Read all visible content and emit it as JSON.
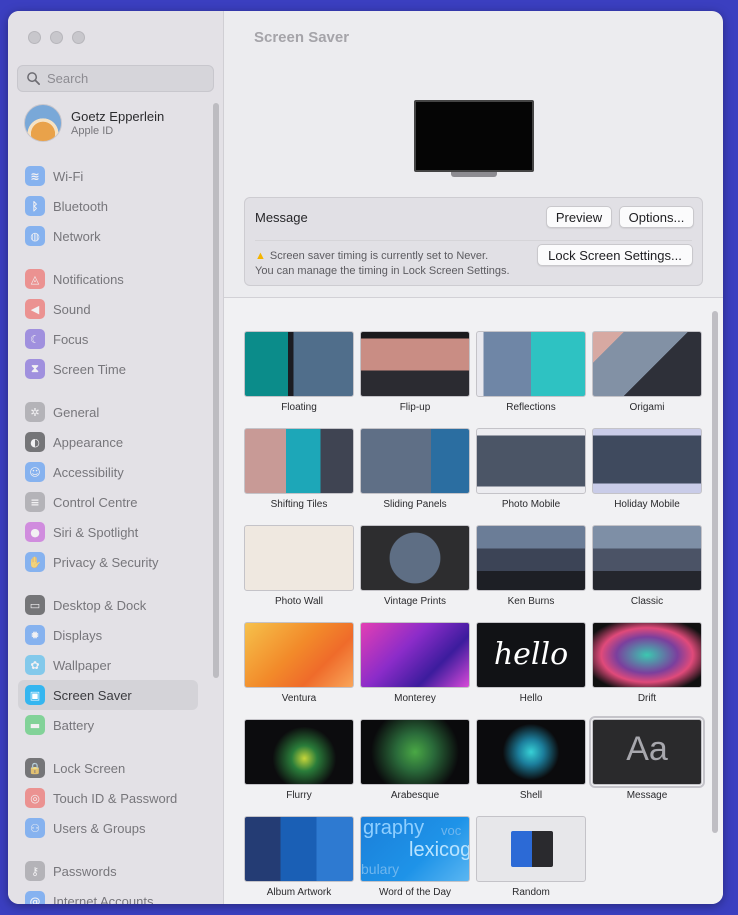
{
  "sidebar": {
    "search_placeholder": "Search",
    "profile": {
      "name": "Goetz Epperlein",
      "subtitle": "Apple ID"
    },
    "items": [
      {
        "label": "Wi-Fi",
        "icon": "wifi-icon",
        "color": "#3b8cf7"
      },
      {
        "label": "Bluetooth",
        "icon": "bluetooth-icon",
        "color": "#3b8cf7"
      },
      {
        "label": "Network",
        "icon": "globe-icon",
        "color": "#3b8cf7"
      },
      {
        "label": "Notifications",
        "icon": "bell-icon",
        "color": "#f2534c"
      },
      {
        "label": "Sound",
        "icon": "speaker-icon",
        "color": "#f2534c"
      },
      {
        "label": "Focus",
        "icon": "moon-icon",
        "color": "#6b4fd8"
      },
      {
        "label": "Screen Time",
        "icon": "hourglass-icon",
        "color": "#6b4fd8"
      },
      {
        "label": "General",
        "icon": "gear-icon",
        "color": "#8e8e93"
      },
      {
        "label": "Appearance",
        "icon": "appearance-icon",
        "color": "#1d1d1f"
      },
      {
        "label": "Accessibility",
        "icon": "accessibility-icon",
        "color": "#3b8cf7"
      },
      {
        "label": "Control Centre",
        "icon": "toggles-icon",
        "color": "#8e8e93"
      },
      {
        "label": "Siri & Spotlight",
        "icon": "siri-icon",
        "color": "#c148d8"
      },
      {
        "label": "Privacy & Security",
        "icon": "hand-icon",
        "color": "#3b8cf7"
      },
      {
        "label": "Desktop & Dock",
        "icon": "dock-icon",
        "color": "#1d1d1f"
      },
      {
        "label": "Displays",
        "icon": "sun-icon",
        "color": "#3b8cf7"
      },
      {
        "label": "Wallpaper",
        "icon": "flower-icon",
        "color": "#35b6f0"
      },
      {
        "label": "Screen Saver",
        "icon": "screensaver-icon",
        "color": "#35b6f0",
        "active": true
      },
      {
        "label": "Battery",
        "icon": "battery-icon",
        "color": "#34c759"
      },
      {
        "label": "Lock Screen",
        "icon": "lock-icon",
        "color": "#1d1d1f"
      },
      {
        "label": "Touch ID & Password",
        "icon": "fingerprint-icon",
        "color": "#f2534c"
      },
      {
        "label": "Users & Groups",
        "icon": "users-icon",
        "color": "#3b8cf7"
      },
      {
        "label": "Passwords",
        "icon": "key-icon",
        "color": "#8e8e93"
      },
      {
        "label": "Internet Accounts",
        "icon": "at-icon",
        "color": "#3b8cf7"
      }
    ]
  },
  "main": {
    "title": "Screen Saver",
    "panel": {
      "title": "Message",
      "preview_label": "Preview",
      "options_label": "Options...",
      "warning_line1": "Screen saver timing is currently set to Never.",
      "warning_line2": "You can manage the timing in Lock Screen Settings.",
      "lock_settings_label": "Lock Screen Settings..."
    },
    "savers": [
      "Floating",
      "Flip-up",
      "Reflections",
      "Origami",
      "Shifting Tiles",
      "Sliding Panels",
      "Photo Mobile",
      "Holiday Mobile",
      "Photo Wall",
      "Vintage Prints",
      "Ken Burns",
      "Classic",
      "Ventura",
      "Monterey",
      "Hello",
      "Drift",
      "Flurry",
      "Arabesque",
      "Shell",
      "Message",
      "Album Artwork",
      "Word of the Day",
      "Random"
    ],
    "thumb_text": {
      "hello": "hello",
      "message": "Aa",
      "word1": "graphy",
      "word2": "lexicog",
      "word3": "bulary",
      "word4": "voc"
    },
    "selected_saver": "Message"
  }
}
